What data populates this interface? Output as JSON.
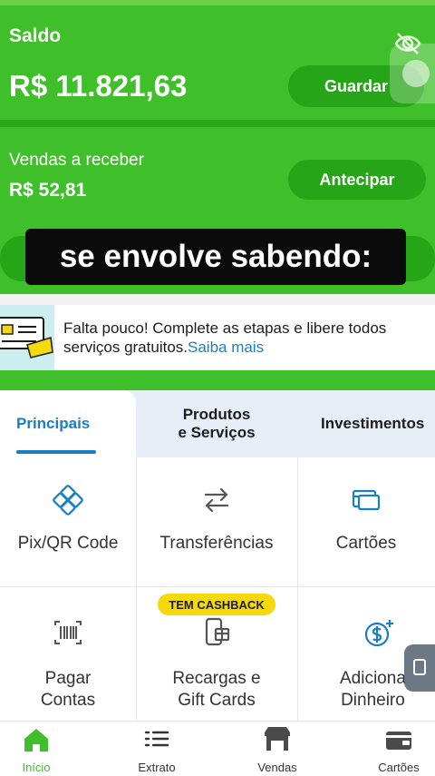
{
  "balance": {
    "label": "Saldo",
    "amount": "R$ 11.821,63",
    "save_button": "Guardar"
  },
  "receivables": {
    "label": "Vendas a receber",
    "amount": "R$ 52,81",
    "advance_button": "Antecipar"
  },
  "video_subtitle": "se envolve sabendo:",
  "banner": {
    "text": "Falta pouco! Complete as etapas e libere todos serviços gratuitos.",
    "link": "Saiba mais"
  },
  "tabs": [
    {
      "label": "Principais"
    },
    {
      "label_line1": "Produtos",
      "label_line2": "e Serviços"
    },
    {
      "label": "Investimentos"
    }
  ],
  "services": [
    {
      "label": "Pix/QR Code",
      "icon": "pix-icon"
    },
    {
      "label": "Transferências",
      "icon": "transfer-icon"
    },
    {
      "label": "Cartões",
      "icon": "card-icon"
    },
    {
      "label_line1": "Pagar",
      "label_line2": "Contas",
      "icon": "barcode-icon"
    },
    {
      "label_line1": "Recargas e",
      "label_line2": "Gift Cards",
      "icon": "phone-gift-icon",
      "badge": "TEM CASHBACK"
    },
    {
      "label_line1": "Adiciona",
      "label_line2": "Dinheiro",
      "icon": "add-money-icon"
    }
  ],
  "bottom_nav": [
    {
      "label": "Início",
      "icon": "home-icon",
      "active": true
    },
    {
      "label": "Extrato",
      "icon": "list-icon"
    },
    {
      "label": "Vendas",
      "icon": "store-icon"
    },
    {
      "label": "Cartões",
      "icon": "wallet-icon"
    }
  ],
  "colors": {
    "brand_green": "#3fbf2a",
    "accent_blue": "#1a7fc0",
    "badge_yellow": "#f5d90a"
  }
}
